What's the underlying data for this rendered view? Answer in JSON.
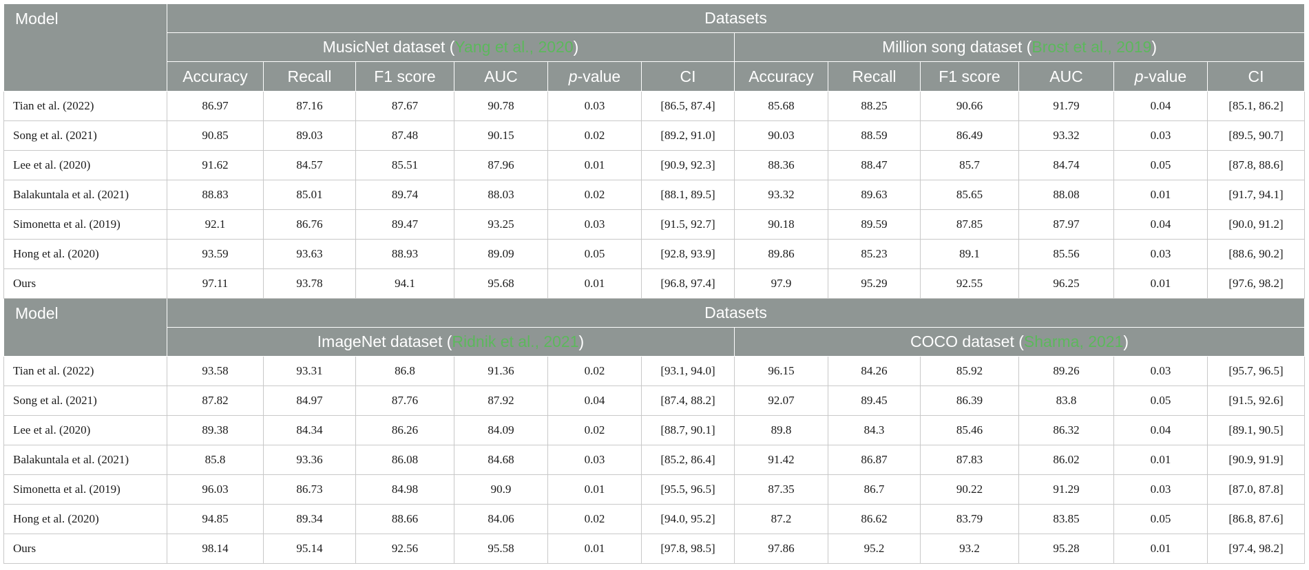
{
  "tables": [
    {
      "model_header": "Model",
      "datasets_header": "Datasets",
      "dataset_groups": [
        {
          "name": "MusicNet dataset (",
          "ref": "Yang et al., 2020",
          "close": ")"
        },
        {
          "name": "Million song dataset (",
          "ref": "Brost et al., 2019",
          "close": ")"
        }
      ],
      "metric_headers": [
        "Accuracy",
        "Recall",
        "F1 score",
        "AUC",
        "p",
        "-value",
        "CI"
      ],
      "rows": [
        {
          "model": "Tian et al. (2022)",
          "cited": true,
          "v": [
            "86.97",
            "87.16",
            "87.67",
            "90.78",
            "0.03",
            "[86.5, 87.4]",
            "85.68",
            "88.25",
            "90.66",
            "91.79",
            "0.04",
            "[85.1, 86.2]"
          ]
        },
        {
          "model": "Song et al. (2021)",
          "cited": true,
          "v": [
            "90.85",
            "89.03",
            "87.48",
            "90.15",
            "0.02",
            "[89.2, 91.0]",
            "90.03",
            "88.59",
            "86.49",
            "93.32",
            "0.03",
            "[89.5, 90.7]"
          ]
        },
        {
          "model": "Lee et al. (2020)",
          "cited": true,
          "v": [
            "91.62",
            "84.57",
            "85.51",
            "87.96",
            "0.01",
            "[90.9, 92.3]",
            "88.36",
            "88.47",
            "85.7",
            "84.74",
            "0.05",
            "[87.8, 88.6]"
          ]
        },
        {
          "model": "Balakuntala et al. (2021)",
          "cited": true,
          "v": [
            "88.83",
            "85.01",
            "89.74",
            "88.03",
            "0.02",
            "[88.1, 89.5]",
            "93.32",
            "89.63",
            "85.65",
            "88.08",
            "0.01",
            "[91.7, 94.1]"
          ]
        },
        {
          "model": "Simonetta et al. (2019)",
          "cited": true,
          "v": [
            "92.1",
            "86.76",
            "89.47",
            "93.25",
            "0.03",
            "[91.5, 92.7]",
            "90.18",
            "89.59",
            "87.85",
            "87.97",
            "0.04",
            "[90.0, 91.2]"
          ]
        },
        {
          "model": "Hong et al. (2020)",
          "cited": true,
          "v": [
            "93.59",
            "93.63",
            "88.93",
            "89.09",
            "0.05",
            "[92.8, 93.9]",
            "89.86",
            "85.23",
            "89.1",
            "85.56",
            "0.03",
            "[88.6, 90.2]"
          ]
        },
        {
          "model": "Ours",
          "cited": false,
          "v": [
            "97.11",
            "93.78",
            "94.1",
            "95.68",
            "0.01",
            "[96.8, 97.4]",
            "97.9",
            "95.29",
            "92.55",
            "96.25",
            "0.01",
            "[97.6, 98.2]"
          ]
        }
      ]
    },
    {
      "model_header": "Model",
      "datasets_header": "Datasets",
      "dataset_groups": [
        {
          "name": "ImageNet dataset (",
          "ref": "Ridnik et al., 2021",
          "close": ")"
        },
        {
          "name": "COCO dataset (",
          "ref": "Sharma, 2021",
          "close": ")"
        }
      ],
      "rows": [
        {
          "model": "Tian et al. (2022)",
          "cited": true,
          "v": [
            "93.58",
            "93.31",
            "86.8",
            "91.36",
            "0.02",
            "[93.1, 94.0]",
            "96.15",
            "84.26",
            "85.92",
            "89.26",
            "0.03",
            "[95.7, 96.5]"
          ]
        },
        {
          "model": "Song et al. (2021)",
          "cited": true,
          "v": [
            "87.82",
            "84.97",
            "87.76",
            "87.92",
            "0.04",
            "[87.4, 88.2]",
            "92.07",
            "89.45",
            "86.39",
            "83.8",
            "0.05",
            "[91.5, 92.6]"
          ]
        },
        {
          "model": "Lee et al. (2020)",
          "cited": true,
          "v": [
            "89.38",
            "84.34",
            "86.26",
            "84.09",
            "0.02",
            "[88.7, 90.1]",
            "89.8",
            "84.3",
            "85.46",
            "86.32",
            "0.04",
            "[89.1, 90.5]"
          ]
        },
        {
          "model": "Balakuntala et al. (2021)",
          "cited": true,
          "v": [
            "85.8",
            "93.36",
            "86.08",
            "84.68",
            "0.03",
            "[85.2, 86.4]",
            "91.42",
            "86.87",
            "87.83",
            "86.02",
            "0.01",
            "[90.9, 91.9]"
          ]
        },
        {
          "model": "Simonetta et al. (2019)",
          "cited": true,
          "v": [
            "96.03",
            "86.73",
            "84.98",
            "90.9",
            "0.01",
            "[95.5, 96.5]",
            "87.35",
            "86.7",
            "90.22",
            "91.29",
            "0.03",
            "[87.0, 87.8]"
          ]
        },
        {
          "model": "Hong et al. (2020)",
          "cited": true,
          "v": [
            "94.85",
            "89.34",
            "88.66",
            "84.06",
            "0.02",
            "[94.0, 95.2]",
            "87.2",
            "86.62",
            "83.79",
            "83.85",
            "0.05",
            "[86.8, 87.6]"
          ]
        },
        {
          "model": "Ours",
          "cited": false,
          "v": [
            "98.14",
            "95.14",
            "92.56",
            "95.58",
            "0.01",
            "[97.8, 98.5]",
            "97.86",
            "95.2",
            "93.2",
            "95.28",
            "0.01",
            "[97.4, 98.2]"
          ]
        }
      ]
    }
  ]
}
